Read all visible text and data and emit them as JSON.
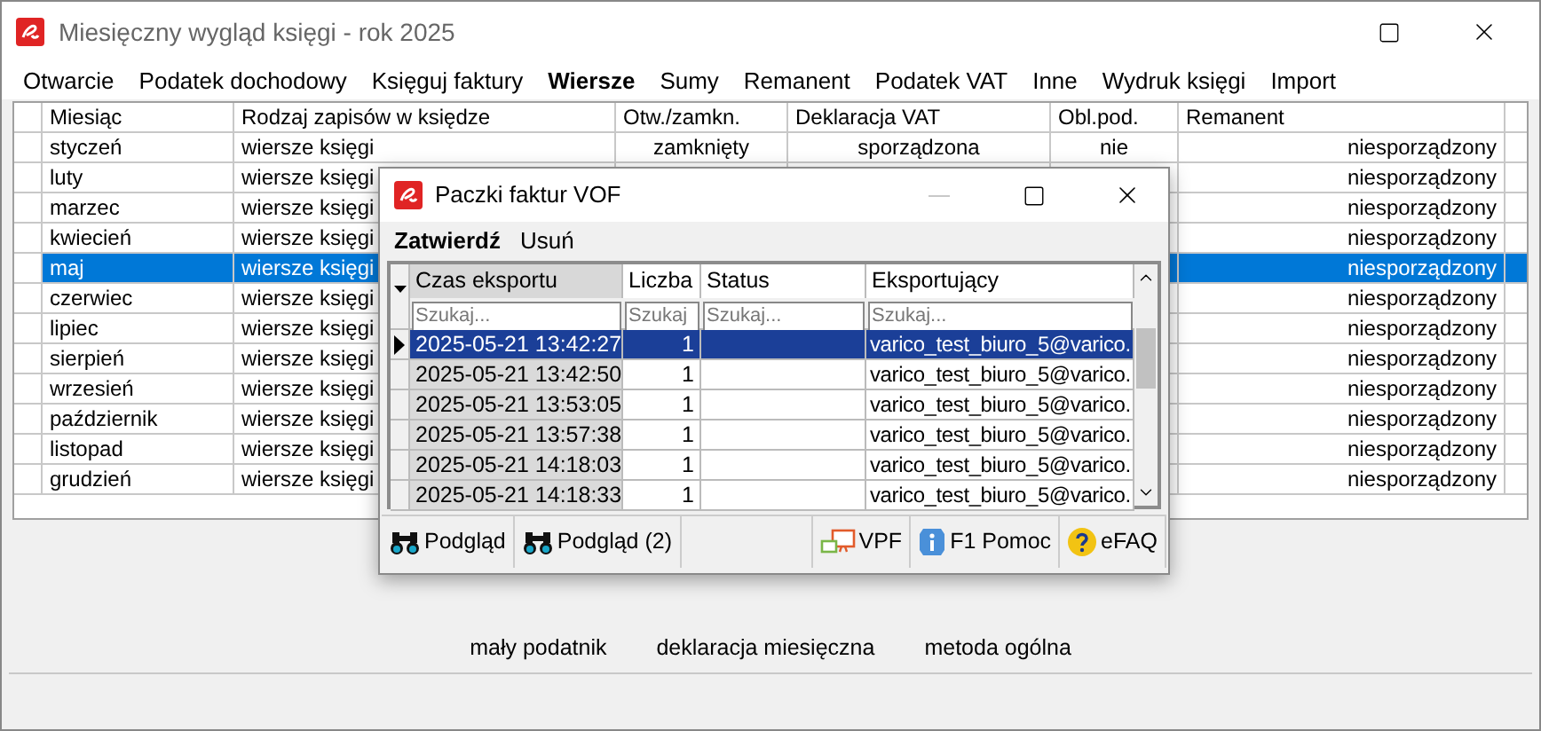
{
  "window": {
    "title": "Miesięczny wygląd księgi - rok 2025"
  },
  "menu": [
    {
      "label": "Otwarcie",
      "selected": false
    },
    {
      "label": "Podatek dochodowy",
      "selected": false
    },
    {
      "label": "Księguj faktury",
      "selected": false
    },
    {
      "label": "Wiersze",
      "selected": true
    },
    {
      "label": "Sumy",
      "selected": false
    },
    {
      "label": "Remanent",
      "selected": false
    },
    {
      "label": "Podatek VAT",
      "selected": false
    },
    {
      "label": "Inne",
      "selected": false
    },
    {
      "label": "Wydruk księgi",
      "selected": false
    },
    {
      "label": "Import",
      "selected": false
    }
  ],
  "table": {
    "columns": [
      "Miesiąc",
      "Rodzaj zapisów w księdze",
      "Otw./zamkn.",
      "Deklaracja VAT",
      "Obl.pod.",
      "Remanent"
    ],
    "rows": [
      {
        "month": "styczeń",
        "type": "wiersze księgi",
        "open_closed": "zamknięty",
        "vat": "sporządzona",
        "tax": "nie",
        "remanent": "niesporządzony",
        "selected": false
      },
      {
        "month": "luty",
        "type": "wiersze księgi",
        "remanent": "niesporządzony",
        "selected": false
      },
      {
        "month": "marzec",
        "type": "wiersze księgi",
        "remanent": "niesporządzony",
        "selected": false
      },
      {
        "month": "kwiecień",
        "type": "wiersze księgi",
        "remanent": "niesporządzony",
        "selected": false
      },
      {
        "month": "maj",
        "type": "wiersze księgi",
        "remanent": "niesporządzony",
        "selected": true
      },
      {
        "month": "czerwiec",
        "type": "wiersze księgi",
        "remanent": "niesporządzony",
        "selected": false
      },
      {
        "month": "lipiec",
        "type": "wiersze księgi",
        "remanent": "niesporządzony",
        "selected": false
      },
      {
        "month": "sierpień",
        "type": "wiersze księgi",
        "remanent": "niesporządzony",
        "selected": false
      },
      {
        "month": "wrzesień",
        "type": "wiersze księgi",
        "remanent": "niesporządzony",
        "selected": false
      },
      {
        "month": "październik",
        "type": "wiersze księgi",
        "remanent": "niesporządzony",
        "selected": false
      },
      {
        "month": "listopad",
        "type": "wiersze księgi",
        "remanent": "niesporządzony",
        "selected": false
      },
      {
        "month": "grudzień",
        "type": "wiersze księgi",
        "remanent": "niesporządzony",
        "selected": false
      }
    ]
  },
  "info_line": [
    "mały podatnik",
    "deklaracja miesięczna",
    "metoda ogólna"
  ],
  "dialog": {
    "title": "Paczki faktur VOF",
    "menu": [
      {
        "label": "Zatwierdź",
        "default": true
      },
      {
        "label": "Usuń",
        "default": false
      }
    ],
    "grid": {
      "columns": [
        {
          "label": "Czas eksportu",
          "placeholder": "Szukaj..."
        },
        {
          "label": "Liczba",
          "placeholder": "Szukaj"
        },
        {
          "label": "Status",
          "placeholder": "Szukaj..."
        },
        {
          "label": "Eksportujący",
          "placeholder": "Szukaj..."
        }
      ],
      "rows": [
        {
          "time": "2025-05-21 13:42:27",
          "count": "1",
          "exporter": "varico_test_biuro_5@varico.",
          "selected": true
        },
        {
          "time": "2025-05-21 13:42:50",
          "count": "1",
          "exporter": "varico_test_biuro_5@varico.",
          "selected": false
        },
        {
          "time": "2025-05-21 13:53:05",
          "count": "1",
          "exporter": "varico_test_biuro_5@varico.",
          "selected": false
        },
        {
          "time": "2025-05-21 13:57:38",
          "count": "1",
          "exporter": "varico_test_biuro_5@varico.",
          "selected": false
        },
        {
          "time": "2025-05-21 14:18:03",
          "count": "1",
          "exporter": "varico_test_biuro_5@varico.",
          "selected": false
        },
        {
          "time": "2025-05-21 14:18:33",
          "count": "1",
          "exporter": "varico_test_biuro_5@varico.",
          "selected": false
        }
      ]
    },
    "toolbar": [
      {
        "kind": "binoculars",
        "label": "Podgląd"
      },
      {
        "kind": "binoculars",
        "label": "Podgląd (2)"
      },
      {
        "kind": "spacer"
      },
      {
        "kind": "vpf",
        "label": "VPF"
      },
      {
        "kind": "info",
        "label": "F1 Pomoc"
      },
      {
        "kind": "help",
        "label": "eFAQ"
      }
    ]
  }
}
